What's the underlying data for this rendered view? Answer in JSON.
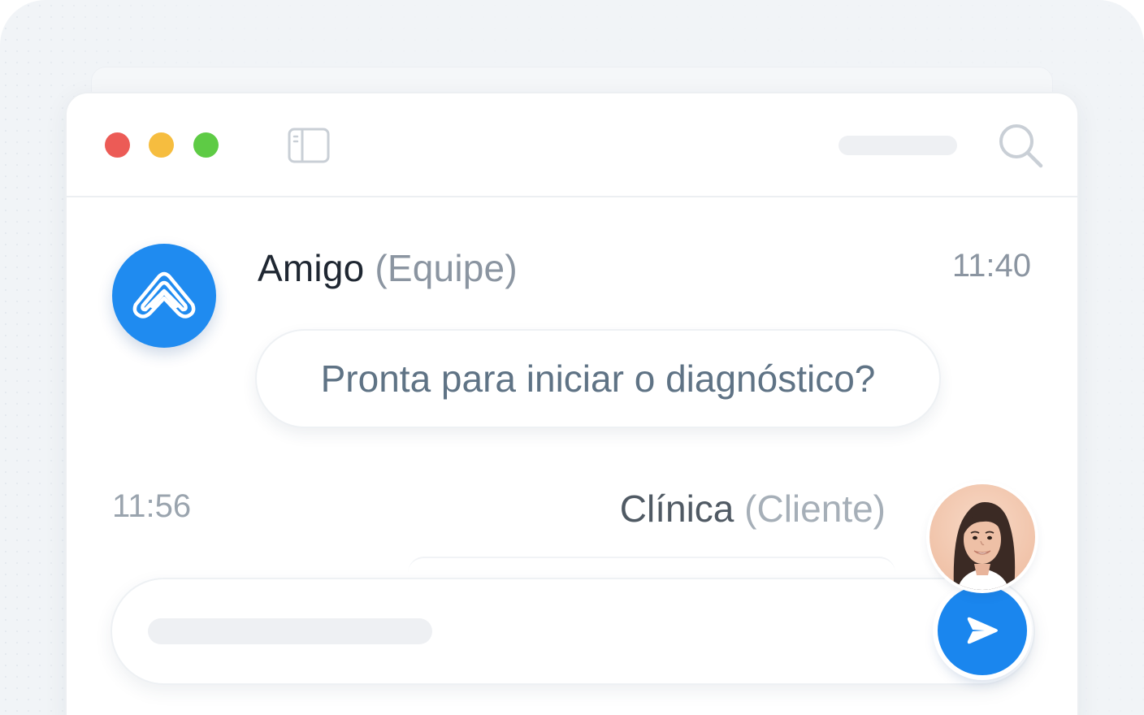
{
  "window": {
    "controls": [
      "close",
      "minimize",
      "maximize"
    ]
  },
  "toolbar": {
    "sidebar_icon": "sidebar-toggle-icon",
    "search_icon": "search-icon"
  },
  "messages": [
    {
      "sender": "Amigo",
      "role": "(Equipe)",
      "time": "11:40",
      "text": "Pronta para iniciar o diagnóstico?",
      "avatar_icon": "amigo-logo-icon"
    },
    {
      "sender": "Clínica",
      "role": "(Cliente)",
      "time": "11:56",
      "avatar_icon": "user-avatar"
    }
  ],
  "composer": {
    "send_icon": "send-icon"
  },
  "colors": {
    "accent": "#1a86ee",
    "close": "#ec5b56",
    "minimize": "#f6bd3f",
    "maximize": "#5ecb45"
  }
}
